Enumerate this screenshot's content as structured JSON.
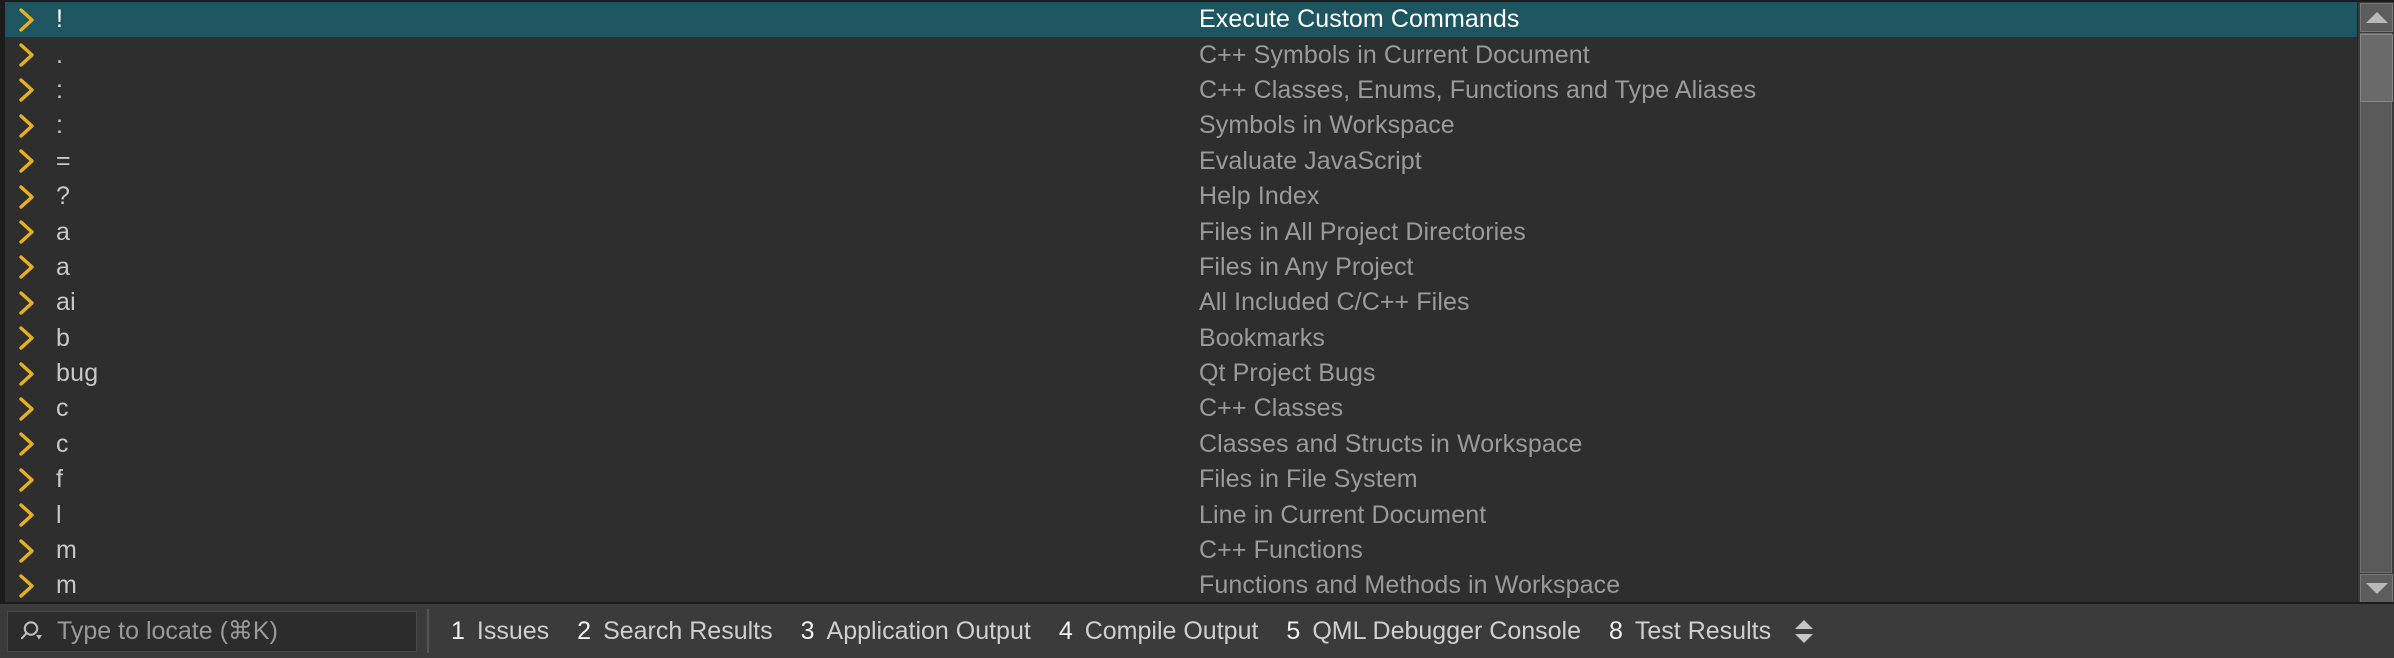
{
  "colors": {
    "background": "#2e2e2e",
    "selected_row": "#1d5561",
    "chevron": "#e8b021",
    "prefix_text": "#c8c8c8",
    "description_text": "#9b9b9b",
    "statusbar_background": "#3b3b3b"
  },
  "locator_popup": {
    "rows": [
      {
        "prefix": "!",
        "description": "Execute Custom Commands",
        "selected": true
      },
      {
        "prefix": ".",
        "description": "C++ Symbols in Current Document",
        "selected": false
      },
      {
        "prefix": ":",
        "description": "C++ Classes, Enums, Functions and Type Aliases",
        "selected": false
      },
      {
        "prefix": ":",
        "description": "Symbols in Workspace",
        "selected": false
      },
      {
        "prefix": "=",
        "description": "Evaluate JavaScript",
        "selected": false
      },
      {
        "prefix": "?",
        "description": "Help Index",
        "selected": false
      },
      {
        "prefix": "a",
        "description": "Files in All Project Directories",
        "selected": false
      },
      {
        "prefix": "a",
        "description": "Files in Any Project",
        "selected": false
      },
      {
        "prefix": "ai",
        "description": "All Included C/C++ Files",
        "selected": false
      },
      {
        "prefix": "b",
        "description": "Bookmarks",
        "selected": false
      },
      {
        "prefix": "bug",
        "description": "Qt Project Bugs",
        "selected": false
      },
      {
        "prefix": "c",
        "description": "C++ Classes",
        "selected": false
      },
      {
        "prefix": "c",
        "description": "Classes and Structs in Workspace",
        "selected": false
      },
      {
        "prefix": "f",
        "description": "Files in File System",
        "selected": false
      },
      {
        "prefix": "l",
        "description": "Line in Current Document",
        "selected": false
      },
      {
        "prefix": "m",
        "description": "C++ Functions",
        "selected": false
      },
      {
        "prefix": "m",
        "description": "Functions and Methods in Workspace",
        "selected": false
      }
    ],
    "scrollbar": {
      "up_arrow": "scroll-up-arrow",
      "down_arrow": "scroll-down-arrow"
    }
  },
  "statusbar": {
    "locator": {
      "icon": "search-icon",
      "placeholder": "Type to locate (⌘K)",
      "value": ""
    },
    "items": [
      {
        "num": "1",
        "label": "Issues"
      },
      {
        "num": "2",
        "label": "Search Results"
      },
      {
        "num": "3",
        "label": "Application Output"
      },
      {
        "num": "4",
        "label": "Compile Output"
      },
      {
        "num": "5",
        "label": "QML Debugger Console"
      },
      {
        "num": "8",
        "label": "Test Results"
      }
    ],
    "stepper": "output-pane-stepper"
  }
}
